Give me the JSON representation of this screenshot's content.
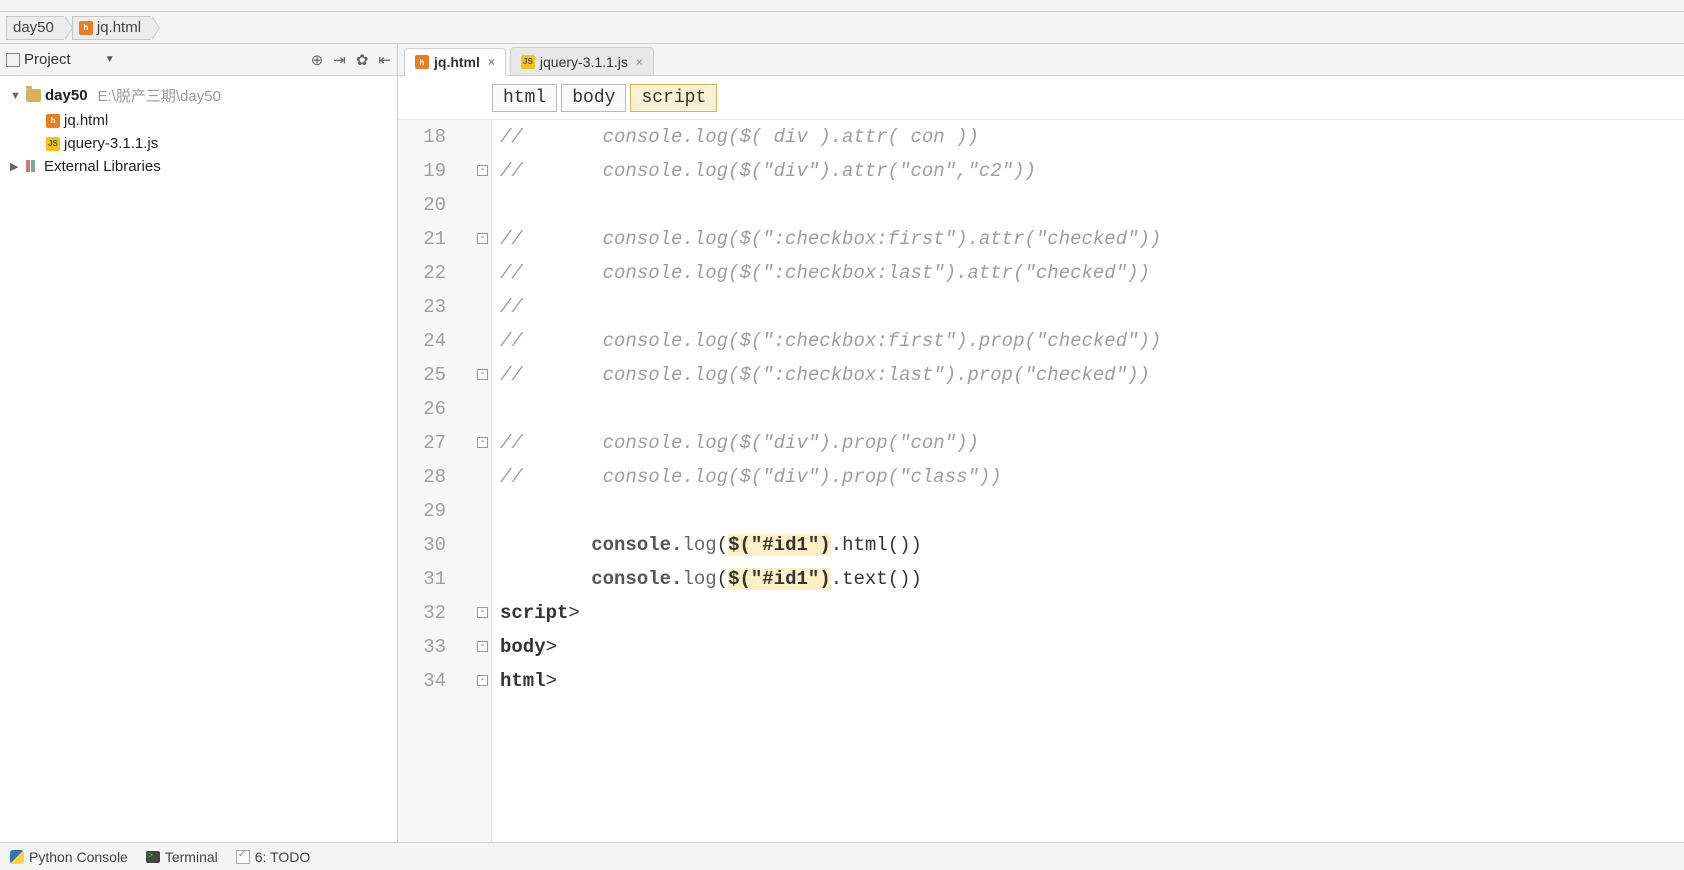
{
  "breadcrumb": {
    "root": "day50",
    "file": "jq.html"
  },
  "projectPanel": {
    "title": "Project",
    "tree": {
      "root": {
        "name": "day50",
        "path": "E:\\脱产三期\\day50"
      },
      "files": [
        {
          "name": "jq.html",
          "type": "html"
        },
        {
          "name": "jquery-3.1.1.js",
          "type": "js"
        }
      ],
      "externalLib": "External Libraries"
    }
  },
  "tabs": [
    {
      "label": "jq.html",
      "type": "html",
      "active": true
    },
    {
      "label": "jquery-3.1.1.js",
      "type": "js",
      "active": false
    }
  ],
  "navCrumbs": [
    "html",
    "body",
    "script"
  ],
  "code": {
    "startLine": 18,
    "lines": [
      {
        "n": 18,
        "kind": "cmt",
        "text": "//       console.log($( div ).attr( con ))"
      },
      {
        "n": 19,
        "kind": "cmt",
        "text": "//       console.log($(\"div\").attr(\"con\",\"c2\"))"
      },
      {
        "n": 20,
        "kind": "blank",
        "text": ""
      },
      {
        "n": 21,
        "kind": "cmt",
        "text": "//       console.log($(\":checkbox:first\").attr(\"checked\"))"
      },
      {
        "n": 22,
        "kind": "cmt",
        "text": "//       console.log($(\":checkbox:last\").attr(\"checked\"))"
      },
      {
        "n": 23,
        "kind": "cmt",
        "text": "//"
      },
      {
        "n": 24,
        "kind": "cmt",
        "text": "//       console.log($(\":checkbox:first\").prop(\"checked\"))"
      },
      {
        "n": 25,
        "kind": "cmt",
        "text": "//       console.log($(\":checkbox:last\").prop(\"checked\"))"
      },
      {
        "n": 26,
        "kind": "blank",
        "text": ""
      },
      {
        "n": 27,
        "kind": "cmt",
        "text": "//       console.log($(\"div\").prop(\"con\"))"
      },
      {
        "n": 28,
        "kind": "cmt",
        "text": "//       console.log($(\"div\").prop(\"class\"))"
      },
      {
        "n": 29,
        "kind": "blank",
        "text": ""
      },
      {
        "n": 30,
        "kind": "code",
        "console": "console.",
        "log": "log",
        "pre": "(",
        "sel": "$(\"#id1\")",
        "post": ".html())"
      },
      {
        "n": 31,
        "kind": "code",
        "console": "console.",
        "log": "log",
        "pre": "(",
        "sel": "$(\"#id1\")",
        "post": ".text())",
        "current": true
      },
      {
        "n": 32,
        "kind": "tag",
        "open": "</",
        "name": "script",
        "close": ">"
      },
      {
        "n": 33,
        "kind": "tag",
        "open": "</",
        "name": "body",
        "close": ">"
      },
      {
        "n": 34,
        "kind": "tag",
        "open": "</",
        "name": "html",
        "close": ">"
      }
    ]
  },
  "bottomBar": {
    "python": "Python Console",
    "terminal": "Terminal",
    "todo": "6: TODO"
  }
}
